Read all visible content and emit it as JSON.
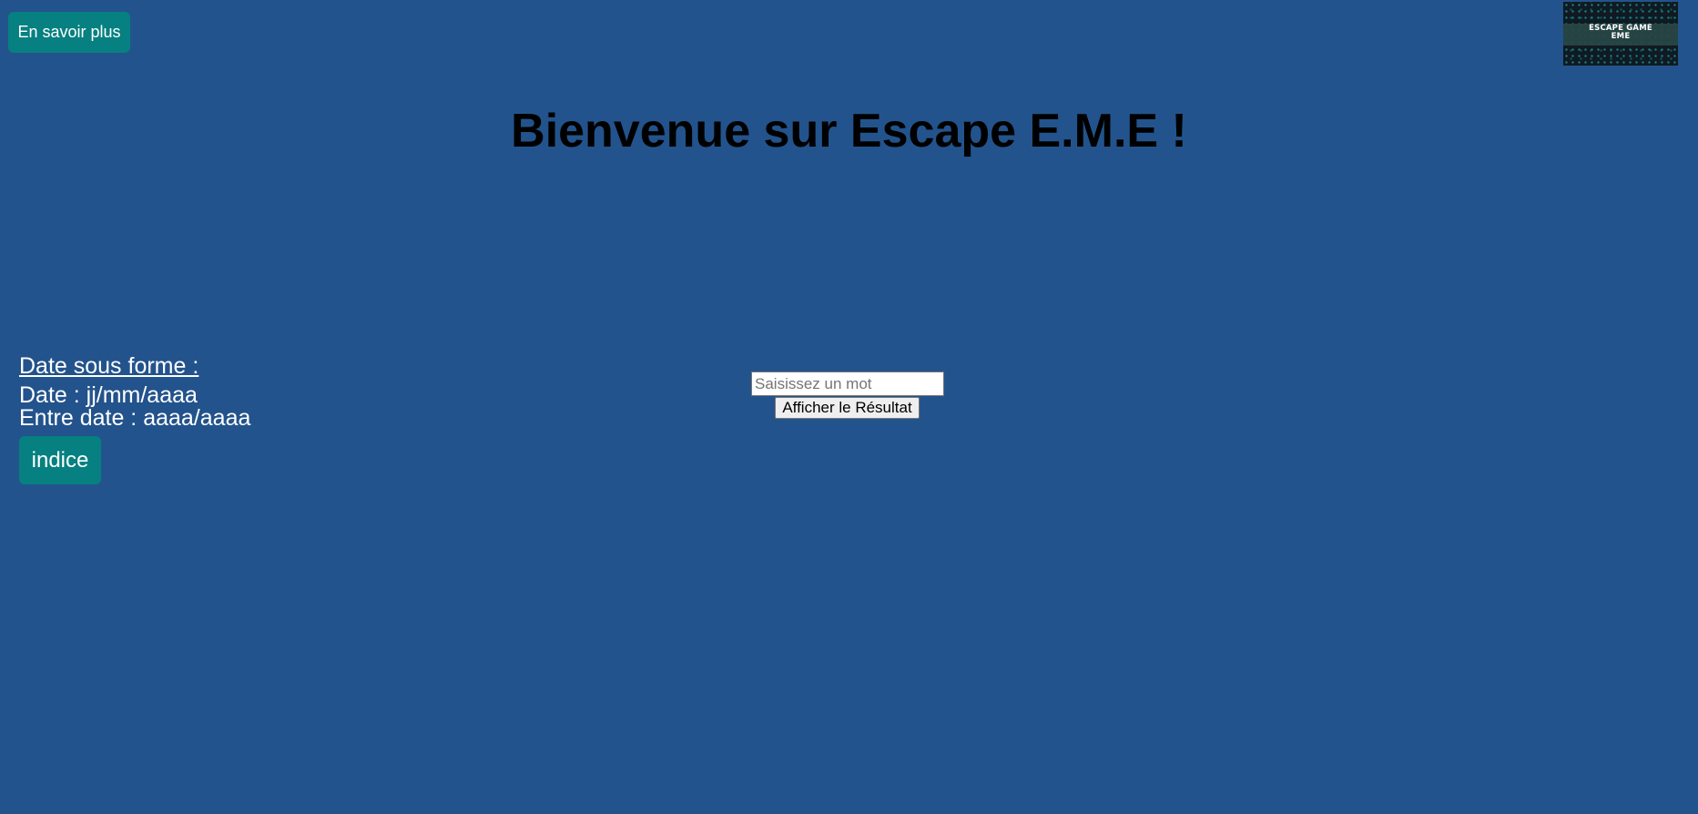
{
  "header": {
    "info_button_label": "En savoir plus",
    "logo": {
      "title": "ESCAPE GAME\nEME",
      "icon": "escape-game-logo"
    }
  },
  "main": {
    "title": "Bienvenue sur Escape E.M.E !",
    "date_help": {
      "heading": "Date sous forme :",
      "lines": [
        "Date : jj/mm/aaaa",
        "Entre date : aaaa/aaaa"
      ]
    },
    "hint_button_label": "indice",
    "search": {
      "placeholder": "Saisissez un mot",
      "value": "",
      "submit_label": "Afficher le Résultat"
    }
  },
  "colors": {
    "background": "#23538c",
    "button_teal": "#068080",
    "title_text": "#000000",
    "help_text": "#ffffff"
  }
}
